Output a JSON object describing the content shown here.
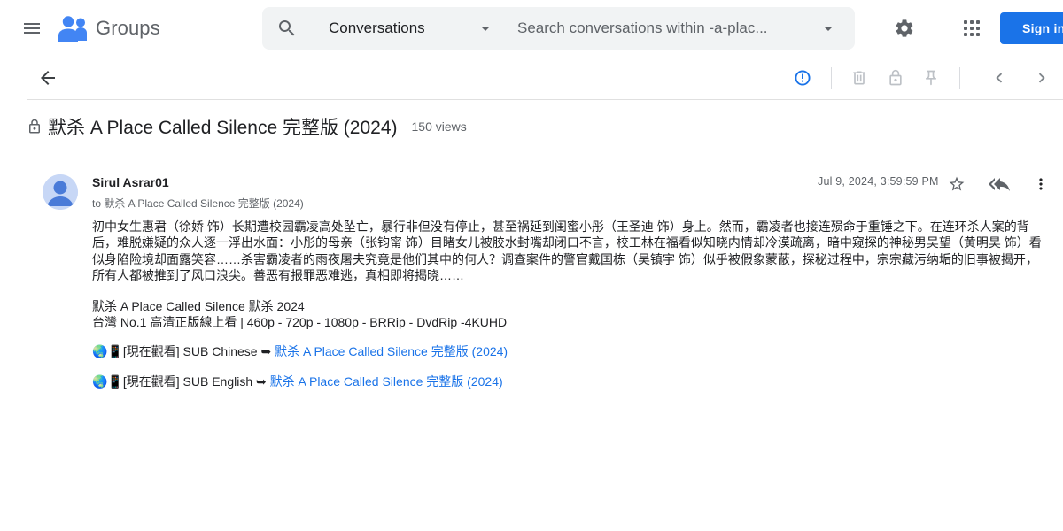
{
  "header": {
    "app_name": "Groups",
    "icons": {
      "menu": "menu-icon",
      "logo": "groups-logo-icon",
      "search": "search-icon",
      "settings": "gear-icon",
      "apps": "apps-grid-icon"
    },
    "search": {
      "scope": "Conversations",
      "placeholder": "Search conversations within -a-plac..."
    },
    "sign_in": "Sign in"
  },
  "toolbar": {
    "icons": [
      "arrow-back-icon",
      "report-abuse-icon",
      "delete-icon",
      "lock-icon",
      "pin-icon",
      "chevron-left-icon",
      "chevron-right-icon"
    ]
  },
  "thread": {
    "title": "默杀 A Place Called Silence 完整版 (2024)",
    "views": "150 views",
    "locked": true
  },
  "message": {
    "author": "Sirul Asrar01",
    "recipient": "to 默杀 A Place Called Silence 完整版 (2024)",
    "timestamp": "Jul 9, 2024, 3:59:59 PM",
    "body": {
      "paragraph": "初中女生惠君（徐娇 饰）长期遭校园霸凌高处坠亡，暴行非但没有停止，甚至祸延到闺蜜小彤（王圣迪 饰）身上。然而，霸凌者也接连殒命于重锤之下。在连环杀人案的背后，难脱嫌疑的众人逐一浮出水面：小彤的母亲（张钧甯 饰）目睹女儿被胶水封嘴却闭口不言，校工林在福看似知晓内情却冷漠疏离，暗中窥探的神秘男吴望（黄明昊 饰）看似身陷险境却面露笑容……杀害霸凌者的雨夜屠夫究竟是他们其中的何人？调查案件的警官戴国栋（吴镇宇 饰）似乎被假象蒙蔽，探秘过程中，宗宗藏污纳垢的旧事被揭开，所有人都被推到了风口浪尖。善恶有报罪恶难逃，真相即将揭晓……",
      "line1": "默杀 A Place Called Silence 默杀 2024",
      "line2": "台灣 No.1 高清正版線上看 | 460p - 720p - 1080p - BRRip - DvdRip -4KUHD",
      "link1_prefix": "🌏📱[現在觀看] SUB Chinese ➥ ",
      "link1_text": "默杀 A Place Called Silence 完整版 (2024)",
      "link2_prefix": "🌏📱[現在觀看] SUB English ➥ ",
      "link2_text": "默杀 A Place Called Silence 完整版 (2024)"
    }
  },
  "colors": {
    "primary_blue": "#1a73e8",
    "text": "#202124",
    "secondary_text": "#5f6368",
    "search_bg": "#f1f3f4"
  }
}
